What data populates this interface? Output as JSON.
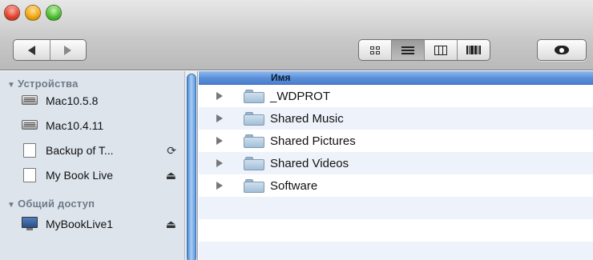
{
  "toolbar": {
    "back_icon": "back-arrow-icon",
    "forward_icon": "forward-arrow-icon",
    "view_modes": [
      "icon-view",
      "list-view",
      "column-view",
      "cover-flow-view"
    ],
    "active_view": "list-view",
    "quicklook_icon": "eye-icon"
  },
  "sidebar": {
    "sections": [
      {
        "header": "Устройства",
        "items": [
          {
            "label": "Mac10.5.8",
            "icon": "hard-drive-icon",
            "action": ""
          },
          {
            "label": "Mac10.4.11",
            "icon": "hard-drive-icon",
            "action": ""
          },
          {
            "label": "Backup of T...",
            "icon": "disk-image-icon",
            "action": "sync-icon"
          },
          {
            "label": "My Book Live",
            "icon": "disk-image-icon",
            "action": "eject-icon"
          }
        ]
      },
      {
        "header": "Общий доступ",
        "items": [
          {
            "label": "MyBookLive1",
            "icon": "network-computer-icon",
            "action": "eject-icon"
          }
        ]
      }
    ]
  },
  "list": {
    "column_name": "Имя",
    "rows": [
      {
        "name": "_WDPROT"
      },
      {
        "name": "Shared Music"
      },
      {
        "name": "Shared Pictures"
      },
      {
        "name": "Shared Videos"
      },
      {
        "name": "Software"
      }
    ]
  },
  "colors": {
    "sidebar_bg": "#dde4ec",
    "header_blue": "#5a8fd8",
    "alt_row": "#eef3fb"
  }
}
